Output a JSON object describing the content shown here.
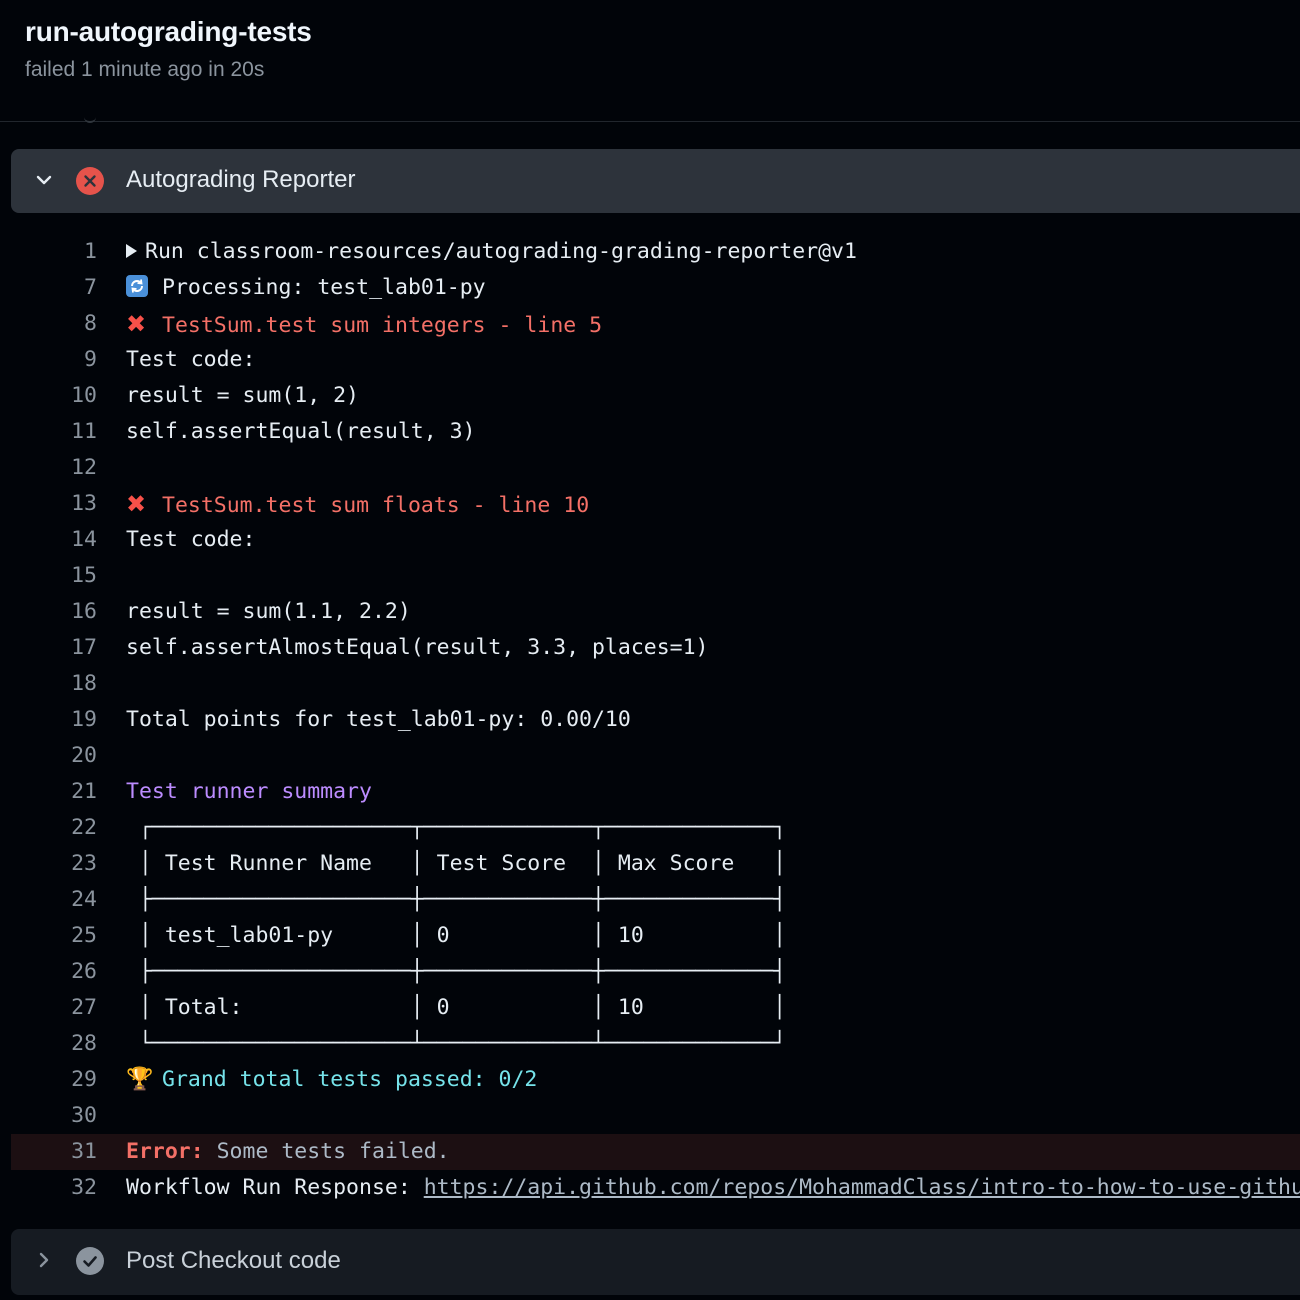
{
  "job": {
    "title": "run-autograding-tests",
    "status": "failed 1 minute ago in 20s"
  },
  "steps": {
    "current": {
      "name": "Autograding Reporter",
      "state": "failed",
      "expanded": true
    },
    "next": {
      "name": "Post Checkout code",
      "state": "success",
      "expanded": false
    }
  },
  "log": [
    {
      "n": "1",
      "text": "Run classroom-resources/autograding-grading-reporter@v1",
      "kind": "group"
    },
    {
      "n": "7",
      "text": "Processing: test_lab01-py",
      "kind": "sync"
    },
    {
      "n": "8",
      "text": "TestSum.test sum integers - line 5",
      "kind": "fail"
    },
    {
      "n": "9",
      "text": "Test code:",
      "kind": "plain"
    },
    {
      "n": "10",
      "text": "result = sum(1, 2)",
      "kind": "plain"
    },
    {
      "n": "11",
      "text": "self.assertEqual(result, 3)",
      "kind": "plain"
    },
    {
      "n": "12",
      "text": "",
      "kind": "plain"
    },
    {
      "n": "13",
      "text": "TestSum.test sum floats - line 10",
      "kind": "fail"
    },
    {
      "n": "14",
      "text": "Test code:",
      "kind": "plain"
    },
    {
      "n": "15",
      "text": "",
      "kind": "plain"
    },
    {
      "n": "16",
      "text": "result = sum(1.1, 2.2)",
      "kind": "plain"
    },
    {
      "n": "17",
      "text": "self.assertAlmostEqual(result, 3.3, places=1)",
      "kind": "plain"
    },
    {
      "n": "18",
      "text": "",
      "kind": "plain"
    },
    {
      "n": "19",
      "text": "Total points for test_lab01-py: 0.00/10",
      "kind": "plain"
    },
    {
      "n": "20",
      "text": "",
      "kind": "plain"
    },
    {
      "n": "21",
      "text": "Test runner summary",
      "kind": "purple"
    },
    {
      "n": "22",
      "text": " ┌────────────────────┬─────────────┬─────────────┐",
      "kind": "plain"
    },
    {
      "n": "23",
      "text": " │ Test Runner Name   │ Test Score  │ Max Score   │",
      "kind": "plain"
    },
    {
      "n": "24",
      "text": " ├────────────────────┼─────────────┼─────────────┤",
      "kind": "plain"
    },
    {
      "n": "25",
      "text": " │ test_lab01-py      │ 0           │ 10          │",
      "kind": "plain"
    },
    {
      "n": "26",
      "text": " ├────────────────────┼─────────────┼─────────────┤",
      "kind": "plain"
    },
    {
      "n": "27",
      "text": " │ Total:             │ 0           │ 10          │",
      "kind": "plain"
    },
    {
      "n": "28",
      "text": " └────────────────────┴─────────────┴─────────────┘",
      "kind": "plain"
    },
    {
      "n": "29",
      "text": "Grand total tests passed: 0/2",
      "kind": "trophy"
    },
    {
      "n": "30",
      "text": "",
      "kind": "plain"
    },
    {
      "n": "31",
      "label": "Error:",
      "text": " Some tests failed.",
      "kind": "error"
    },
    {
      "n": "32",
      "label": "Workflow Run Response: ",
      "text": "https://api.github.com/repos/MohammadClass/intro-to-how-to-use-githu",
      "kind": "link"
    }
  ],
  "icons": {
    "expand": "chevron-down-icon",
    "collapse": "chevron-right-icon",
    "fail": "x-circle-fill-icon",
    "success": "check-circle-fill-icon"
  },
  "colors": {
    "background": "#010409",
    "step_header": "#2d333b",
    "error_text": "#f47067",
    "summary_heading": "#bc8cff",
    "grand_total": "#76e3ea",
    "error_row_bg": "#1c0f12"
  }
}
